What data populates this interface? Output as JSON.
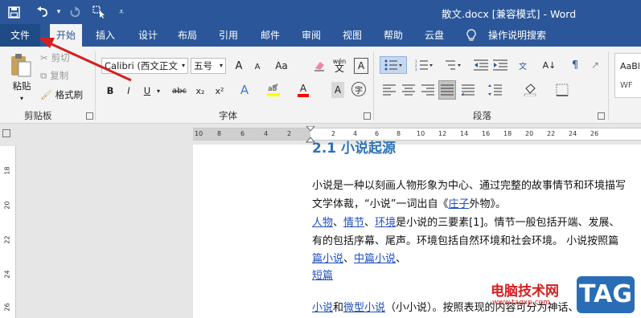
{
  "title": "散文.docx [兼容模式] - Word",
  "quick_access": {
    "save_icon": "save-icon",
    "undo_icon": "undo-icon",
    "redo_icon": "redo-icon",
    "touch_icon": "touch-mode-icon",
    "customize_icon": "customize-icon"
  },
  "tabs": [
    "文件",
    "开始",
    "插入",
    "设计",
    "布局",
    "引用",
    "邮件",
    "审阅",
    "视图",
    "帮助",
    "云盘",
    "操作说明搜索"
  ],
  "active_tab": "开始",
  "clipboard": {
    "paste": "粘贴",
    "cut": "剪切",
    "copy": "复制",
    "format_painter": "格式刷",
    "label": "剪贴板"
  },
  "font": {
    "name": "Calibri (西文正文",
    "size": "五号",
    "label": "字体",
    "bold": "B",
    "italic": "I",
    "underline": "U",
    "strike": "abc",
    "sub": "x₂",
    "sup": "x²",
    "grow": "A",
    "shrink": "A",
    "clear": "Aa",
    "phonetic": "wén",
    "aa": "Aa",
    "font_color": "A",
    "highlight": "ab",
    "char_shade": "A",
    "enclose": "字"
  },
  "paragraph": {
    "label": "段落"
  },
  "styles": {
    "sample": "AaBl",
    "sample2": "WF"
  },
  "ruler": {
    "h_ticks": [
      "10",
      "8",
      "6",
      "4",
      "2",
      "",
      "2",
      "4",
      "6",
      "8",
      "10",
      "12",
      "14",
      "16",
      "18",
      "20",
      "22",
      "24",
      "26"
    ],
    "v_ticks": [
      "18",
      "20",
      "22",
      "24",
      "26"
    ]
  },
  "doc": {
    "heading": "2.1 小说起源",
    "p1": "小说是一种以刻画人物形象为中心、通过完整的故事情节和环境描写",
    "p2a": "文学体裁，“小说”一词出自《",
    "p2_link": "庄子",
    "p2b": "外物》。",
    "p3_l1": "人物",
    "p3_sep1": "、",
    "p3_l2": "情节",
    "p3_sep2": "、",
    "p3_l3": "环境",
    "p3_rest": "是小说的三要素[1]。情节一般包括开端、发展、",
    "p4": "有的包括序幕、尾声。环境包括自然环境和社会环境。 小说按照篇",
    "p5_l1": "篇小说",
    "p5_sep": "、",
    "p5_l2": "中篇小说",
    "p5_tail": "、",
    "p6_l1": "短篇",
    "p7_l1": "小说",
    "p7_and": "和",
    "p7_l2": "微型小说",
    "p7_rest": "（小小说）。按照表现的内容可分为神话、仙侠"
  },
  "watermark": {
    "text": "电脑技术网",
    "url": "www.tagxp.com",
    "tag": "TAG"
  },
  "colors": {
    "brand": "#2b579a",
    "annotation": "#d32020"
  }
}
